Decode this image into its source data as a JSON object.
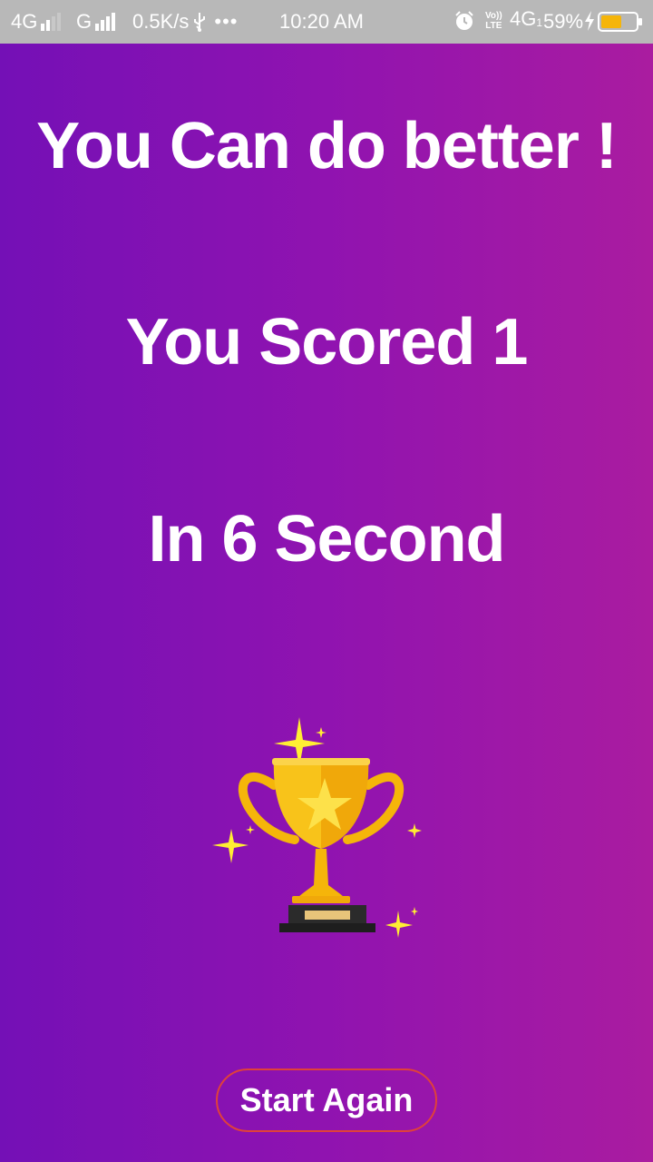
{
  "status_bar": {
    "network1": "4G",
    "network2": "G",
    "speed": "0.5K/s",
    "more": "•••",
    "time": "10:20 AM",
    "volte_top": "Vo))",
    "volte_bottom": "LTE",
    "network3": "4G",
    "sim_index": "1",
    "battery_percent": "59%",
    "battery_level": 0.59,
    "charging": true,
    "icons": [
      "signal-icon",
      "usb-icon",
      "alarm-icon",
      "volte-icon",
      "battery-icon",
      "charging-icon"
    ]
  },
  "result": {
    "message": "You Can do better !",
    "score_text": "You Scored 1",
    "time_text": "In 6 Second"
  },
  "trophy": {
    "icon": "trophy-icon",
    "accent": "#f5b50a",
    "sparkle_color": "#ffee33"
  },
  "actions": {
    "start_again_label": "Start Again",
    "button_border": "#e0413a"
  },
  "colors": {
    "gradient_start": "#7410b6",
    "gradient_end": "#aa1ca0",
    "status_bar": "#b8b8b8"
  }
}
